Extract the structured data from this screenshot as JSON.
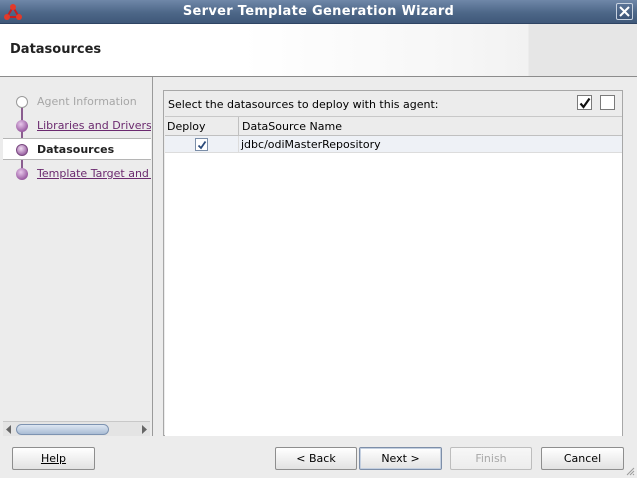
{
  "window": {
    "title": "Server Template Generation Wizard"
  },
  "header": {
    "page_title": "Datasources"
  },
  "steps": [
    {
      "label": "Agent Information",
      "state": "disabled"
    },
    {
      "label": "Libraries and Drivers",
      "state": "link"
    },
    {
      "label": "Datasources",
      "state": "current"
    },
    {
      "label": "Template Target and Summary",
      "state": "link"
    }
  ],
  "content": {
    "instruction": "Select the datasources to deploy with this agent:",
    "columns": [
      "Deploy",
      "DataSource Name"
    ],
    "rows": [
      {
        "deploy": true,
        "name": "jdbc/odiMasterRepository"
      }
    ]
  },
  "buttons": {
    "help": "Help",
    "back": "< Back",
    "next": "Next >",
    "finish": "Finish",
    "cancel": "Cancel"
  },
  "colors": {
    "titlebar": "#4d6788",
    "step_link": "#6b2a6f",
    "step_dot": "#9a5ca2"
  }
}
